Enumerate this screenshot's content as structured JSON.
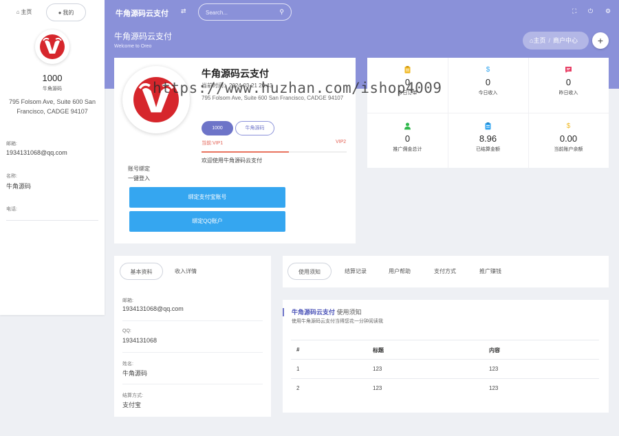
{
  "sidebar": {
    "tabs": [
      {
        "label": "主页"
      },
      {
        "label": "我的"
      }
    ],
    "balance": "1000",
    "name": "牛角源码",
    "address": "795 Folsom Ave, Suite 600 San Francisco, CADGE 94107",
    "fields": [
      {
        "label": "邮箱:",
        "value": "1934131068@qq.com"
      },
      {
        "label": "名称:",
        "value": "牛角源码"
      },
      {
        "label": "电话:",
        "value": ""
      }
    ]
  },
  "topbar": {
    "brand": "牛角源码云支付",
    "search_placeholder": "Search..."
  },
  "hero": {
    "title": "牛角源码云支付",
    "subtitle": "Welcome to Oreo"
  },
  "breadcrumb": {
    "home": "主页",
    "sep": "/",
    "current": "商户中心"
  },
  "profile": {
    "name": "牛角源码云支付",
    "time": "当前时间：2024-03-21 20:43",
    "address": "795 Folsom Ave, Suite 600 San Francisco, CADGE 94107",
    "badge_primary": "1000",
    "badge_secondary": "牛角源码",
    "vip_from": "当前:VIP1",
    "vip_to": "VIP2",
    "vip_progress": 0.6,
    "welcome": "欢迎使用牛角源码云支付",
    "account_label": "账号绑定",
    "account_sub": "一键登入",
    "buttons": [
      "绑定支付宝账号",
      "绑定QQ账户"
    ]
  },
  "stats": [
    {
      "icon": "clipboard-icon",
      "value": "0",
      "label": "今日订单",
      "color": "#f0b823"
    },
    {
      "icon": "dollar-icon",
      "value": "0",
      "label": "今日收入",
      "color": "#35a6f0"
    },
    {
      "icon": "message-icon",
      "value": "0",
      "label": "昨日收入",
      "color": "#e83e64"
    },
    {
      "icon": "user-icon",
      "value": "0",
      "label": "推广佣金总计",
      "color": "#2fb84b"
    },
    {
      "icon": "clipboard-icon",
      "value": "8.96",
      "label": "已结算金额",
      "color": "#35a6f0"
    },
    {
      "icon": "dollar-icon",
      "value": "0.00",
      "label": "当前账户余额",
      "color": "#f0b823"
    }
  ],
  "watermark": "https://www.huzhan.com/ishop4009",
  "info": {
    "tabs": [
      "基本资料",
      "收入详情"
    ],
    "fields": [
      {
        "label": "邮箱:",
        "value": "1934131068@qq.com"
      },
      {
        "label": "QQ:",
        "value": "1934131068"
      },
      {
        "label": "姓名:",
        "value": "牛角源码"
      },
      {
        "label": "结算方式:",
        "value": "支付宝"
      }
    ]
  },
  "notice_tabs": [
    "使用须知",
    "结算记录",
    "用户帮助",
    "支付方式",
    "推广赚钱"
  ],
  "notice": {
    "title_bold": "牛角源码云支付",
    "title_rest": "使用须知",
    "subtitle": "使用牛角源码云支付当得您花一分钟阅读我",
    "columns": [
      "#",
      "标题",
      "内容"
    ],
    "rows": [
      [
        "1",
        "123",
        "123"
      ],
      [
        "2",
        "123",
        "123"
      ]
    ]
  }
}
